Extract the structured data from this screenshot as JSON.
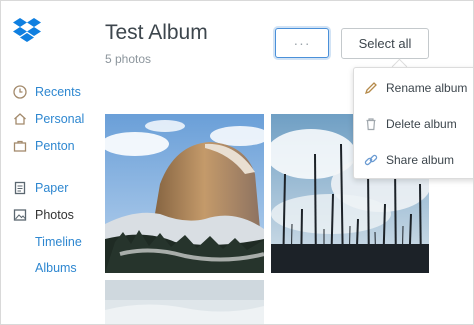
{
  "brand": {
    "icon": "dropbox-logo-icon",
    "color": "#0061fe"
  },
  "sidebar": {
    "items": [
      {
        "label": "Recents",
        "icon": "clock-icon"
      },
      {
        "label": "Personal",
        "icon": "home-icon"
      },
      {
        "label": "Penton",
        "icon": "briefcase-icon"
      },
      {
        "label": "Paper",
        "icon": "paper-icon"
      },
      {
        "label": "Photos",
        "icon": "photo-icon"
      },
      {
        "label": "Timeline"
      },
      {
        "label": "Albums"
      }
    ]
  },
  "album": {
    "title": "Test Album",
    "count": "5 photos"
  },
  "toolbar": {
    "more_label": "···",
    "select_all_label": "Select all"
  },
  "menu": {
    "items": [
      {
        "label": "Rename album",
        "icon": "pencil-icon"
      },
      {
        "label": "Delete album",
        "icon": "trash-icon"
      },
      {
        "label": "Share album",
        "icon": "link-icon"
      }
    ]
  },
  "photos": [
    {
      "subject": "half-dome-cliff-photo"
    },
    {
      "subject": "burned-trees-photo"
    },
    {
      "subject": "snowy-landscape-photo"
    }
  ],
  "colors": {
    "link": "#2e87d0",
    "text": "#3d464d",
    "muted": "#8c959c",
    "focus": "#4a90d9"
  }
}
